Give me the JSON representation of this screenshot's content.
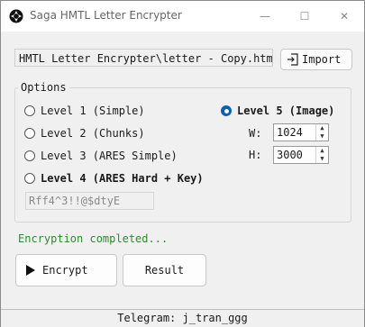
{
  "window": {
    "title": "Saga HMTL Letter Encrypter",
    "controls": {
      "minimize": "—",
      "maximize": "☐",
      "close": "✕"
    }
  },
  "file": {
    "path_value": "HMTL Letter Encrypter\\letter - Copy.html",
    "import_label": "Import",
    "import_icon": "import-icon"
  },
  "options": {
    "legend": "Options",
    "levels": [
      {
        "label": "Level 1 (Simple)",
        "selected": false
      },
      {
        "label": "Level 2 (Chunks)",
        "selected": false
      },
      {
        "label": "Level 3 (ARES Simple)",
        "selected": false
      },
      {
        "label": "Level 4 (ARES Hard + Key)",
        "selected": false
      },
      {
        "label": "Level 5 (Image)",
        "selected": true
      }
    ],
    "width_label": "W:",
    "width_value": "1024",
    "height_label": "H:",
    "height_value": "3000",
    "key_value": "Rff4^3!!@$dtyE"
  },
  "status": {
    "text": "Encryption completed...",
    "color": "#2e8b2e"
  },
  "actions": {
    "encrypt_label": "Encrypt",
    "result_label": "Result"
  },
  "footer": {
    "text": "Telegram: j_tran_ggg"
  },
  "colors": {
    "accent": "#0a5fb8"
  }
}
